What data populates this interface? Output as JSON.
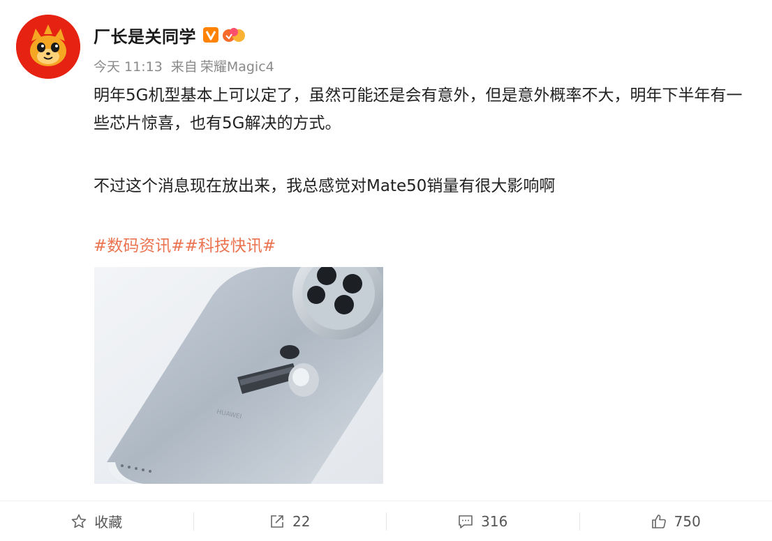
{
  "user": {
    "name": "厂长是关同学",
    "verified_icon": "verified-v-icon",
    "level_icon": "level-badge-icon",
    "avatar_icon": "cartoon-face-avatar"
  },
  "meta": {
    "time": "今天 11:13",
    "from_label": "来自",
    "device": "荣耀Magic4"
  },
  "post": {
    "paragraph_1": "明年5G机型基本上可以定了，虽然可能还是会有意外，但是意外概率不大，明年下半年有一些芯片惊喜，也有5G解决的方式。",
    "paragraph_2": "不过这个消息现在放出来，我总感觉对Mate50销量有很大影响啊",
    "tags": [
      "#数码资讯#",
      "#科技快讯#"
    ],
    "image": {
      "subject": "phone-and-earbud-photo",
      "phone_brand_text": "HUAWEI"
    }
  },
  "actions": {
    "favorite": {
      "icon": "star-icon",
      "label": "收藏"
    },
    "repost": {
      "icon": "share-icon",
      "count": "22"
    },
    "comment": {
      "icon": "comment-icon",
      "count": "316"
    },
    "like": {
      "icon": "thumbs-up-icon",
      "count": "750"
    }
  },
  "colors": {
    "tag": "#eb7350",
    "avatar_bg": "#e62212",
    "verified": "#ff8200"
  }
}
